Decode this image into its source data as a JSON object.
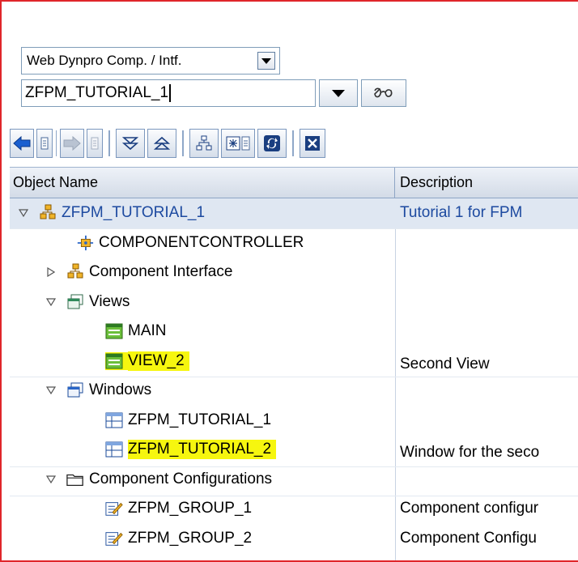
{
  "object_type": {
    "selected": "Web Dynpro Comp. / Intf."
  },
  "object_name": {
    "value": "ZFPM_TUTORIAL_1"
  },
  "toolbar": {
    "icons": [
      "back-icon",
      "back-menu-icon",
      "forward-icon",
      "forward-menu-icon",
      "expand-all-icon",
      "collapse-all-icon",
      "hierarchy-icon",
      "display-object-icon",
      "refresh-icon",
      "close-icon"
    ]
  },
  "grid": {
    "columns": [
      "Object Name",
      "Description"
    ],
    "rows": [
      {
        "name": "ZFPM_TUTORIAL_1",
        "description": "Tutorial 1 for FPM",
        "icon": "component-icon",
        "expander": "expanded",
        "level": 0
      },
      {
        "name": "COMPONENTCONTROLLER",
        "description": "",
        "icon": "controller-icon",
        "expander": "none",
        "level": 1
      },
      {
        "name": "Component Interface",
        "description": "",
        "icon": "component-icon",
        "expander": "collapsed",
        "level": 1
      },
      {
        "name": "Views",
        "description": "",
        "icon": "views-folder-icon",
        "expander": "expanded",
        "level": 1
      },
      {
        "name": "MAIN",
        "description": "",
        "icon": "view-icon",
        "expander": "none",
        "level": 2
      },
      {
        "name": "VIEW_2",
        "description": "Second View",
        "icon": "view-icon",
        "expander": "none",
        "level": 2,
        "highlighted": true
      },
      {
        "name": "Windows",
        "description": "",
        "icon": "windows-folder-icon",
        "expander": "expanded",
        "level": 1
      },
      {
        "name": "ZFPM_TUTORIAL_1",
        "description": "",
        "icon": "window-icon",
        "expander": "none",
        "level": 2
      },
      {
        "name": "ZFPM_TUTORIAL_2",
        "description": "Window for the seco",
        "icon": "window-icon",
        "expander": "none",
        "level": 2,
        "highlighted": true
      },
      {
        "name": "Component Configurations",
        "description": "",
        "icon": "folder-icon",
        "expander": "expanded",
        "level": 1
      },
      {
        "name": "ZFPM_GROUP_1",
        "description": "Component configur",
        "icon": "configuration-icon",
        "expander": "none",
        "level": 2
      },
      {
        "name": "ZFPM_GROUP_2",
        "description": "Component Configu",
        "icon": "configuration-icon",
        "expander": "none",
        "level": 2
      }
    ]
  },
  "colors": {
    "frame_border": "#e0262a",
    "selected_row": "#dfe7f2",
    "highlight": "#f6f60f",
    "link_text": "#1d4aa0"
  }
}
